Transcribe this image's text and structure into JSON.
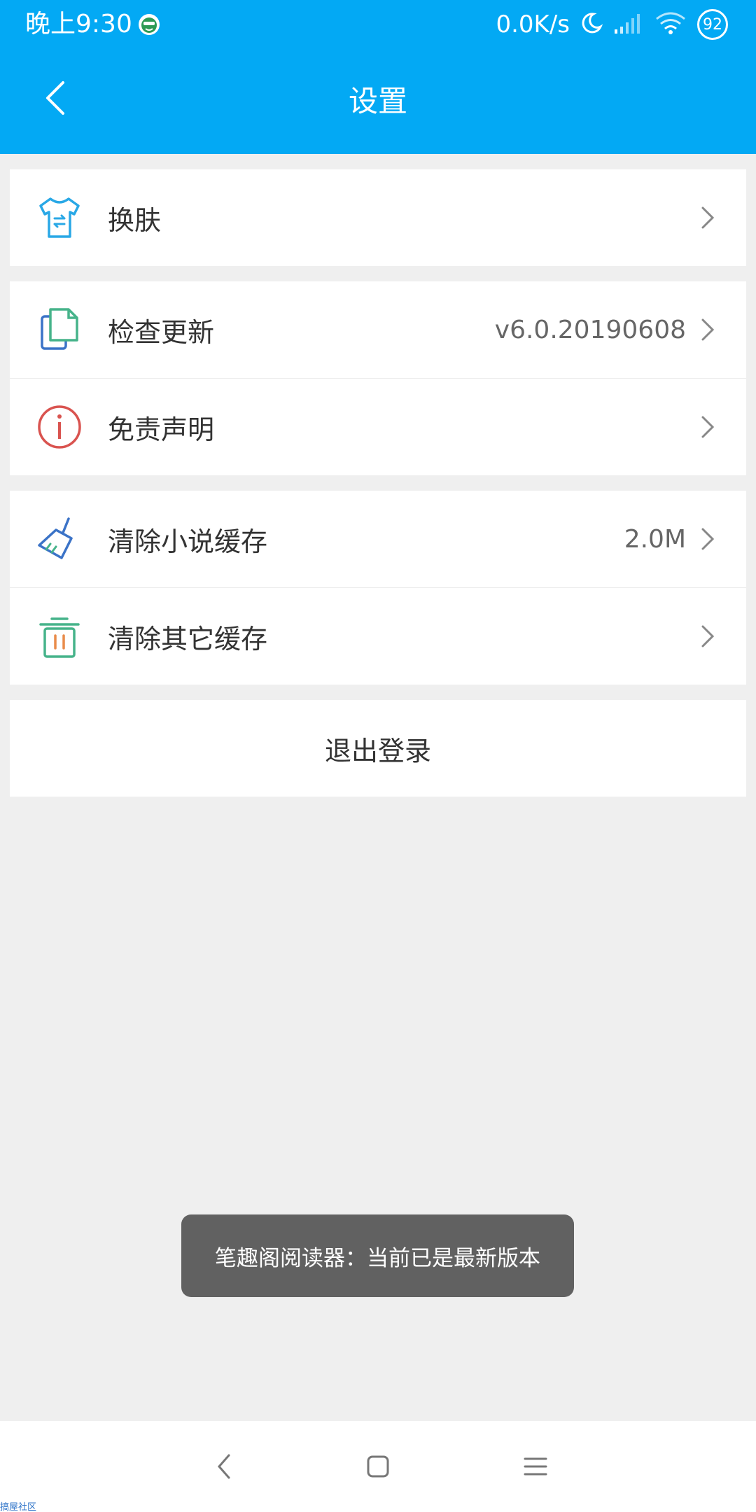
{
  "status_bar": {
    "time": "晚上9:30",
    "net_speed": "0.0K/s",
    "battery": "92"
  },
  "app_bar": {
    "title": "设置"
  },
  "groups": [
    {
      "items": [
        {
          "label": "换肤",
          "value": "",
          "icon": "tshirt-icon"
        }
      ]
    },
    {
      "items": [
        {
          "label": "检查更新",
          "value": "v6.0.20190608",
          "icon": "documents-icon"
        },
        {
          "label": "免责声明",
          "value": "",
          "icon": "info-icon"
        }
      ]
    },
    {
      "items": [
        {
          "label": "清除小说缓存",
          "value": "2.0M",
          "icon": "broom-icon"
        },
        {
          "label": "清除其它缓存",
          "value": "",
          "icon": "trash-icon"
        }
      ]
    }
  ],
  "logout_label": "退出登录",
  "toast": "笔趣阁阅读器：当前已是最新版本",
  "watermark": "搞屋社区",
  "colors": {
    "primary": "#03a9f4",
    "background": "#efefef",
    "toast": "#616161"
  }
}
